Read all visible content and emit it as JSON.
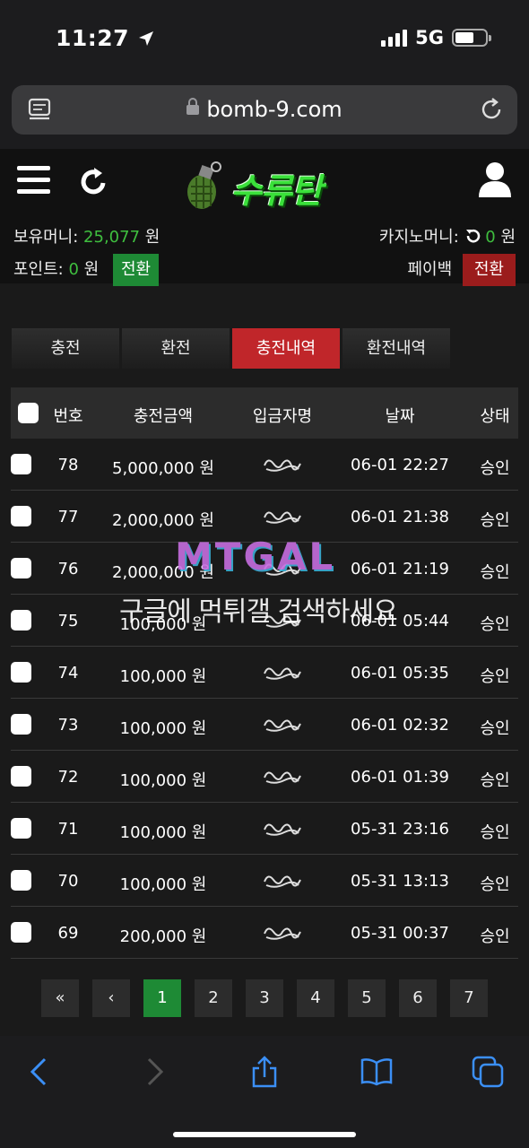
{
  "status_bar": {
    "time": "11:27",
    "network": "5G"
  },
  "browser": {
    "url": "bomb-9.com"
  },
  "site": {
    "logo_text": "수류탄",
    "balance_label": "보유머니:",
    "balance_value": "25,077",
    "balance_unit": "원",
    "casino_label": "카지노머니:",
    "casino_value": "0",
    "casino_unit": "원",
    "points_label": "포인트:",
    "points_value": "0",
    "points_unit": "원",
    "convert_label": "전환",
    "paybook_label": "페이백",
    "paybook_button": "전환"
  },
  "tabs": [
    {
      "label": "충전",
      "active": false
    },
    {
      "label": "환전",
      "active": false
    },
    {
      "label": "충전내역",
      "active": true
    },
    {
      "label": "환전내역",
      "active": false
    }
  ],
  "table": {
    "headers": [
      "번호",
      "충전금액",
      "입금자명",
      "날짜",
      "상태"
    ],
    "rows": [
      {
        "no": "78",
        "amount": "5,000,000 원",
        "date": "06-01 22:27",
        "status": "승인"
      },
      {
        "no": "77",
        "amount": "2,000,000 원",
        "date": "06-01 21:38",
        "status": "승인"
      },
      {
        "no": "76",
        "amount": "2,000,000 원",
        "date": "06-01 21:19",
        "status": "승인"
      },
      {
        "no": "75",
        "amount": "100,000 원",
        "date": "06-01 05:44",
        "status": "승인"
      },
      {
        "no": "74",
        "amount": "100,000 원",
        "date": "06-01 05:35",
        "status": "승인"
      },
      {
        "no": "73",
        "amount": "100,000 원",
        "date": "06-01 02:32",
        "status": "승인"
      },
      {
        "no": "72",
        "amount": "100,000 원",
        "date": "06-01 01:39",
        "status": "승인"
      },
      {
        "no": "71",
        "amount": "100,000 원",
        "date": "05-31 23:16",
        "status": "승인"
      },
      {
        "no": "70",
        "amount": "100,000 원",
        "date": "05-31 13:13",
        "status": "승인"
      },
      {
        "no": "69",
        "amount": "200,000 원",
        "date": "05-31 00:37",
        "status": "승인"
      }
    ]
  },
  "pagination": {
    "first": "«",
    "prev": "‹",
    "pages": [
      "1",
      "2",
      "3",
      "4",
      "5",
      "6",
      "7"
    ],
    "current": "1"
  },
  "watermark": {
    "logo": "MTGAL",
    "text": "구글에 먹튀갤 검색하세요"
  },
  "colors": {
    "accent_green": "#1e8a35",
    "accent_red": "#c0262a",
    "money_green": "#3fbf3f",
    "logo_green": "#3ae03a"
  }
}
